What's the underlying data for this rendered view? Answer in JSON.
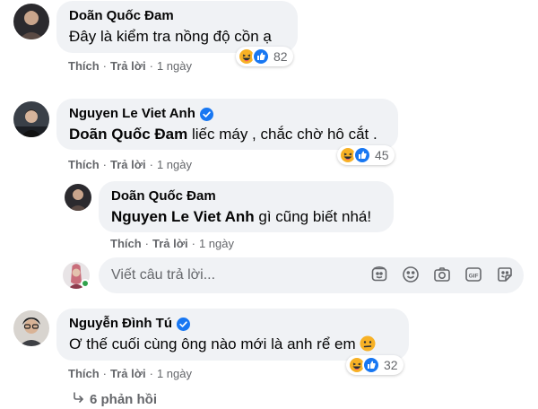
{
  "comments": [
    {
      "author": "Doãn Quốc Đam",
      "text": "Đây là kiểm tra nồng độ cồn ạ",
      "like_label": "Thích",
      "reply_label": "Trả lời",
      "time": "1 ngày",
      "reaction_count": "82"
    },
    {
      "author": "Nguyen Le Viet Anh",
      "mention": "Doãn Quốc Đam",
      "text": "liếc máy , chắc chờ hô cắt .",
      "like_label": "Thích",
      "reply_label": "Trả lời",
      "time": "1 ngày",
      "reaction_count": "45"
    },
    {
      "author": "Nguyễn Đình Tú",
      "text": "Ơ thế cuối cùng ông nào mới là anh rể em",
      "like_label": "Thích",
      "reply_label": "Trả lời",
      "time": "1 ngày",
      "reaction_count": "32"
    }
  ],
  "reply": {
    "author": "Doãn Quốc Đam",
    "mention": "Nguyen Le Viet Anh",
    "text": "gì cũng biết nhá!",
    "like_label": "Thích",
    "reply_label": "Trả lời",
    "time": "1 ngày"
  },
  "reply_input": {
    "placeholder": "Viết câu trả lời..."
  },
  "more_replies": "6 phản hồi",
  "colors": {
    "bubble": "#f0f2f5",
    "meta_text": "#65676b",
    "like_blue": "#1877f2",
    "haha_yellow": "#f7b125",
    "online_green": "#31a24c"
  },
  "icons": [
    "haha-icon",
    "like-icon",
    "verified-icon",
    "sticker-icon",
    "emoji-icon",
    "camera-icon",
    "gif-icon",
    "sticker-face-icon",
    "reply-arrow-icon"
  ]
}
